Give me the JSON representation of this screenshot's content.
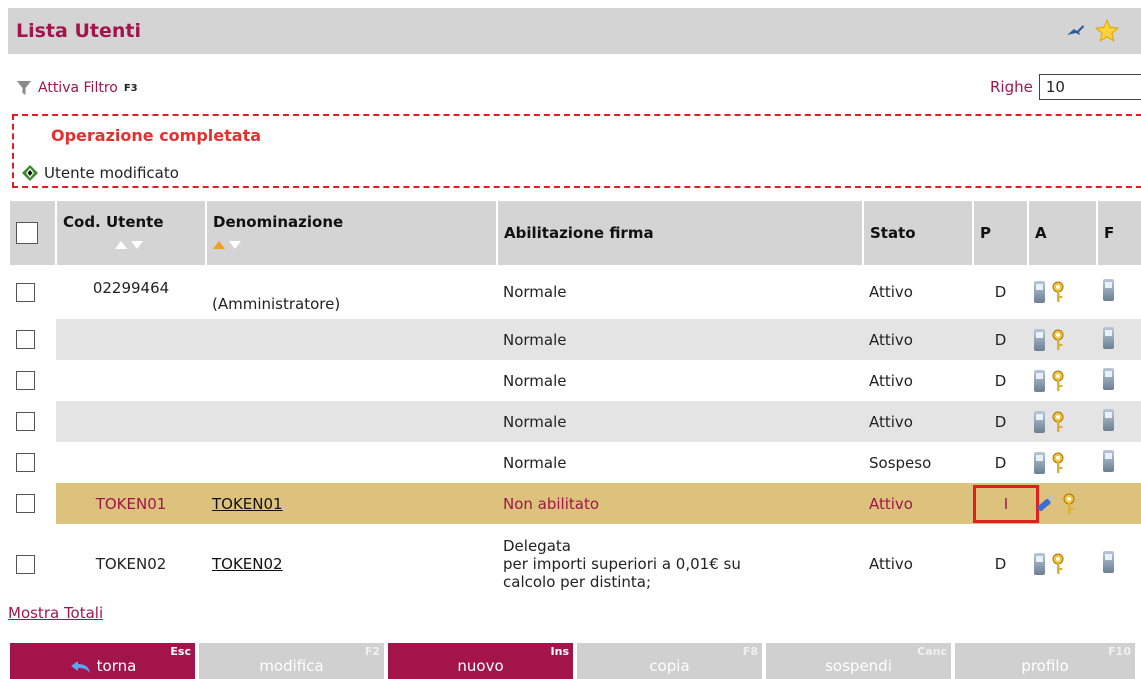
{
  "header": {
    "title": "Lista Utenti"
  },
  "filter": {
    "label": "Attiva Filtro",
    "key": "F3"
  },
  "rows_select": {
    "label": "Righe",
    "value": "10"
  },
  "message": {
    "title": "Operazione completata",
    "text": "Utente modificato"
  },
  "table": {
    "headers": {
      "cod": "Cod. Utente",
      "denominazione": "Denominazione",
      "abilitazione": "Abilitazione firma",
      "stato": "Stato",
      "p": "P",
      "a": "A",
      "f": "F"
    },
    "rows": [
      {
        "cod": "02299464",
        "den": "(Amministratore)",
        "abil": "Normale",
        "stato": "Attivo",
        "p": "D"
      },
      {
        "cod": "",
        "den": "",
        "abil": "Normale",
        "stato": "Attivo",
        "p": "D"
      },
      {
        "cod": "",
        "den": "",
        "abil": "Normale",
        "stato": "Attivo",
        "p": "D"
      },
      {
        "cod": "",
        "den": "",
        "abil": "Normale",
        "stato": "Attivo",
        "p": "D"
      },
      {
        "cod": "",
        "den": "",
        "abil": "Normale",
        "stato": "Sospeso",
        "p": "D"
      },
      {
        "cod": "TOKEN01",
        "den": "TOKEN01",
        "abil": "Non abilitato",
        "stato": "Attivo",
        "p": "I"
      },
      {
        "cod": "TOKEN02",
        "den": "TOKEN02",
        "abil_l1": "Delegata",
        "abil_l2": "per importi superiori a 0,01€ su",
        "abil_l3": "calcolo per distinta;",
        "stato": "Attivo",
        "p": "D"
      }
    ]
  },
  "mostra_totali": "Mostra Totali",
  "buttons": {
    "torna": {
      "label": "torna",
      "key": "Esc"
    },
    "modifica": {
      "label": "modifica",
      "key": "F2"
    },
    "nuovo": {
      "label": "nuovo",
      "key": "Ins"
    },
    "copia": {
      "label": "copia",
      "key": "F8"
    },
    "sospendi": {
      "label": "sospendi",
      "key": "Canc"
    },
    "profilo": {
      "label": "profilo",
      "key": "F10"
    }
  },
  "colors": {
    "brand": "#a3154a",
    "highlight_row": "#dcc27d",
    "error": "#e02020"
  }
}
